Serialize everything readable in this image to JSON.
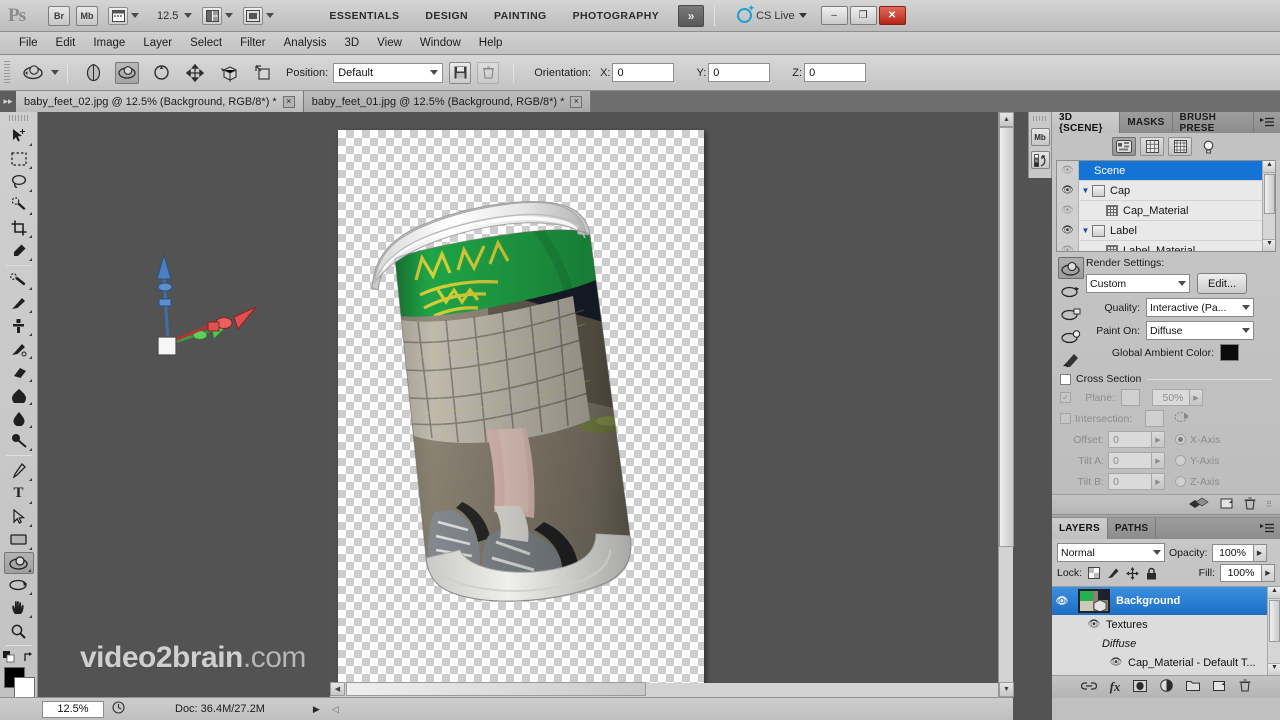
{
  "app": {
    "logo": "Ps",
    "bridge_label": "Br",
    "minibridge_label": "Mb",
    "zoom_level": "12.5",
    "workspaces": [
      "ESSENTIALS",
      "DESIGN",
      "PAINTING",
      "PHOTOGRAPHY"
    ],
    "more_workspaces": "»",
    "cs_live": "CS Live",
    "window_controls": {
      "minimize": "–",
      "restore": "❐",
      "close": "✕"
    }
  },
  "menubar": [
    "File",
    "Edit",
    "Image",
    "Layer",
    "Select",
    "Filter",
    "Analysis",
    "3D",
    "View",
    "Window",
    "Help"
  ],
  "options_bar": {
    "position_label": "Position:",
    "position_value": "Default",
    "orientation_label": "Orientation:",
    "x_label": "X:",
    "x_value": "0",
    "y_label": "Y:",
    "y_value": "0",
    "z_label": "Z:",
    "z_value": "0"
  },
  "doc_tabs": [
    {
      "title": "baby_feet_02.jpg @ 12.5% (Background, RGB/8*) *",
      "active": true
    },
    {
      "title": "baby_feet_01.jpg @ 12.5% (Background, RGB/8*) *",
      "active": false
    }
  ],
  "toolbar": {
    "tools": [
      {
        "name": "move-tool",
        "glyph": "➤"
      },
      {
        "name": "rectangular-marquee-tool",
        "glyph": "⬚"
      },
      {
        "name": "lasso-tool",
        "glyph": "◯"
      },
      {
        "name": "quick-selection-tool",
        "glyph": "✐"
      },
      {
        "name": "crop-tool",
        "glyph": "⌗"
      },
      {
        "name": "eyedropper-tool",
        "glyph": "✒"
      },
      {
        "name": "spot-healing-brush-tool",
        "glyph": "❂"
      },
      {
        "name": "brush-tool",
        "glyph": "✎"
      },
      {
        "name": "clone-stamp-tool",
        "glyph": "⚑"
      },
      {
        "name": "history-brush-tool",
        "glyph": "✄"
      },
      {
        "name": "eraser-tool",
        "glyph": "▰"
      },
      {
        "name": "gradient-tool",
        "glyph": "◩"
      },
      {
        "name": "blur-tool",
        "glyph": "●"
      },
      {
        "name": "dodge-tool",
        "glyph": "⚲"
      },
      {
        "name": "pen-tool",
        "glyph": "✒"
      },
      {
        "name": "horizontal-type-tool",
        "glyph": "T"
      },
      {
        "name": "path-selection-tool",
        "glyph": "➤"
      },
      {
        "name": "rectangle-tool",
        "glyph": "▭"
      },
      {
        "name": "3d-object-rotate-tool",
        "glyph": "❁"
      },
      {
        "name": "3d-camera-rotate-tool",
        "glyph": "◔"
      },
      {
        "name": "hand-tool",
        "glyph": "✋"
      },
      {
        "name": "zoom-tool",
        "glyph": "⌕"
      }
    ],
    "foreground_color": "#000000",
    "background_color": "#ffffff"
  },
  "statusbar": {
    "zoom": "12.5%",
    "doc_info": "Doc: 36.4M/27.2M"
  },
  "canvas": {
    "watermark_bold": "video2brain",
    "watermark_light": ".com"
  },
  "panel_3d": {
    "tabs": [
      {
        "label": "3D {SCENE}",
        "active": true
      },
      {
        "label": "MASKS",
        "active": false
      },
      {
        "label": "BRUSH PRESE",
        "active": false
      }
    ],
    "filters": [
      {
        "name": "scene-filter-icon",
        "active": true
      },
      {
        "name": "meshes-filter-icon",
        "active": false
      },
      {
        "name": "materials-filter-icon",
        "active": false
      },
      {
        "name": "lights-filter-icon",
        "active": false
      }
    ],
    "tree": [
      {
        "label": "Scene",
        "type": "scene",
        "indent": 0,
        "selected": true,
        "eye": "dim"
      },
      {
        "label": "Cap",
        "type": "mesh",
        "indent": 1,
        "selected": false,
        "eye": "on"
      },
      {
        "label": "Cap_Material",
        "type": "material",
        "indent": 2,
        "selected": false,
        "eye": "dim"
      },
      {
        "label": "Label",
        "type": "mesh",
        "indent": 1,
        "selected": false,
        "eye": "on"
      },
      {
        "label": "Label_Material",
        "type": "material",
        "indent": 2,
        "selected": false,
        "eye": "dim"
      }
    ],
    "render": {
      "title": "Render Settings:",
      "preset": "Custom",
      "edit_button": "Edit...",
      "quality_label": "Quality:",
      "quality_value": "Interactive (Pa...",
      "paint_on_label": "Paint On:",
      "paint_on_value": "Diffuse",
      "ambient_label": "Global Ambient Color:",
      "ambient_color": "#0b0b0b"
    },
    "cross_section": {
      "title": "Cross Section",
      "enabled": false,
      "plane_label": "Plane:",
      "plane_opacity": "50%",
      "intersection_label": "Intersection:",
      "offset_label": "Offset:",
      "offset_value": "0",
      "tilt_a_label": "Tilt A:",
      "tilt_a_value": "0",
      "tilt_b_label": "Tilt B:",
      "tilt_b_value": "0",
      "axes": [
        {
          "label": "X-Axis",
          "selected": true
        },
        {
          "label": "Y-Axis",
          "selected": false
        },
        {
          "label": "Z-Axis",
          "selected": false
        }
      ]
    }
  },
  "panel_layers": {
    "tabs": [
      {
        "label": "LAYERS",
        "active": true
      },
      {
        "label": "PATHS",
        "active": false
      }
    ],
    "blend_mode": "Normal",
    "opacity_label": "Opacity:",
    "opacity_value": "100%",
    "lock_label": "Lock:",
    "fill_label": "Fill:",
    "fill_value": "100%",
    "layers": [
      {
        "label": "Background",
        "kind": "layer",
        "selected": true,
        "eye": true
      },
      {
        "label": "Textures",
        "kind": "group",
        "selected": false,
        "eye": true
      },
      {
        "label": "Diffuse",
        "kind": "subgroup",
        "selected": false,
        "eye": false
      },
      {
        "label": "Cap_Material - Default T...",
        "kind": "texture",
        "selected": false,
        "eye": true
      }
    ]
  }
}
